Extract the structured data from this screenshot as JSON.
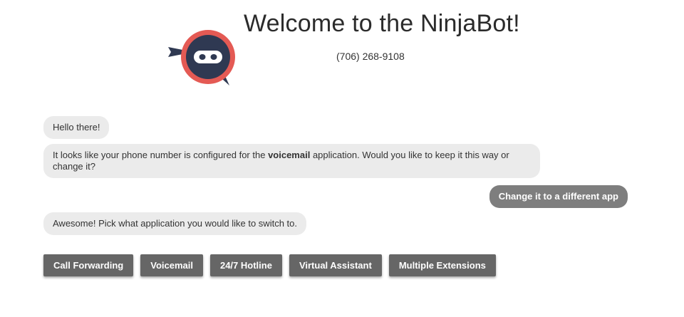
{
  "header": {
    "title": "Welcome to the NinjaBot!",
    "phone": "(706) 268-9108",
    "logo_icon": "ninja-chat-logo"
  },
  "colors": {
    "logo_ring": "#e45a54",
    "logo_face": "#2f3952",
    "bot_bubble": "#ebebeb",
    "user_bubble": "#7e7e7e",
    "option_button": "#666666"
  },
  "chat": {
    "msg1": "Hello there!",
    "msg2_pre": "It looks like your phone number is configured for the ",
    "msg2_app": "voicemail",
    "msg2_post": " application. Would you like to keep it this way or change it?",
    "reply1": "Change it to a different app",
    "msg3": "Awesome! Pick what application you would like to switch to."
  },
  "options": [
    "Call Forwarding",
    "Voicemail",
    "24/7 Hotline",
    "Virtual Assistant",
    "Multiple Extensions"
  ]
}
